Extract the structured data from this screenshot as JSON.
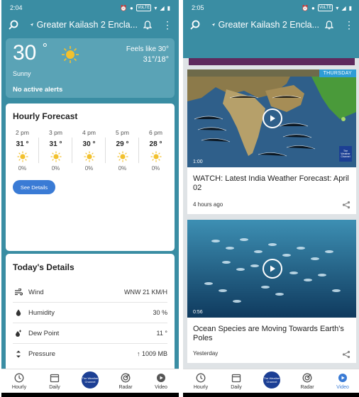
{
  "left": {
    "status": {
      "time": "2:04",
      "volte": "VoLTE"
    },
    "header": {
      "location": "Greater Kailash 2 Encla..."
    },
    "current": {
      "temp": "30",
      "degree": "°",
      "condition": "Sunny",
      "feels_like": "Feels like 30°",
      "hi_lo": "31°/18°",
      "alerts": "No active alerts"
    },
    "hourly": {
      "title": "Hourly Forecast",
      "items": [
        {
          "time": "2 pm",
          "temp": "31 °",
          "precip": "0%"
        },
        {
          "time": "3 pm",
          "temp": "31 °",
          "precip": "0%"
        },
        {
          "time": "4 pm",
          "temp": "30 °",
          "precip": "0%"
        },
        {
          "time": "5 pm",
          "temp": "29 °",
          "precip": "0%"
        },
        {
          "time": "6 pm",
          "temp": "28 °",
          "precip": "0%"
        }
      ],
      "button": "See Details"
    },
    "details": {
      "title": "Today's Details",
      "rows": [
        {
          "label": "Wind",
          "value": "WNW 21 KM/H",
          "icon": "wind-icon"
        },
        {
          "label": "Humidity",
          "value": "30 %",
          "icon": "humidity-drop-icon"
        },
        {
          "label": "Dew Point",
          "value": "11 °",
          "icon": "dew-point-icon"
        },
        {
          "label": "Pressure",
          "value": "↑ 1009 MB",
          "icon": "pressure-icon"
        }
      ]
    }
  },
  "right": {
    "status": {
      "time": "2:05",
      "volte": "VoLTE"
    },
    "header": {
      "location": "Greater Kailash 2 Encla..."
    },
    "videos": [
      {
        "badge": "THURSDAY",
        "duration": "1:00",
        "title": "WATCH: Latest India Weather Forecast: April 02",
        "meta": "4 hours ago"
      },
      {
        "duration": "0:56",
        "title": "Ocean Species are Moving Towards Earth's Poles",
        "meta": "Yesterday"
      }
    ]
  },
  "nav": {
    "items": [
      "Hourly",
      "Daily",
      "Radar",
      "Video"
    ],
    "brand": "The Weather Channel"
  },
  "colors": {
    "teal": "#3a8da3",
    "accent_blue": "#3a7bd5",
    "brand_navy": "#1c3f94"
  }
}
